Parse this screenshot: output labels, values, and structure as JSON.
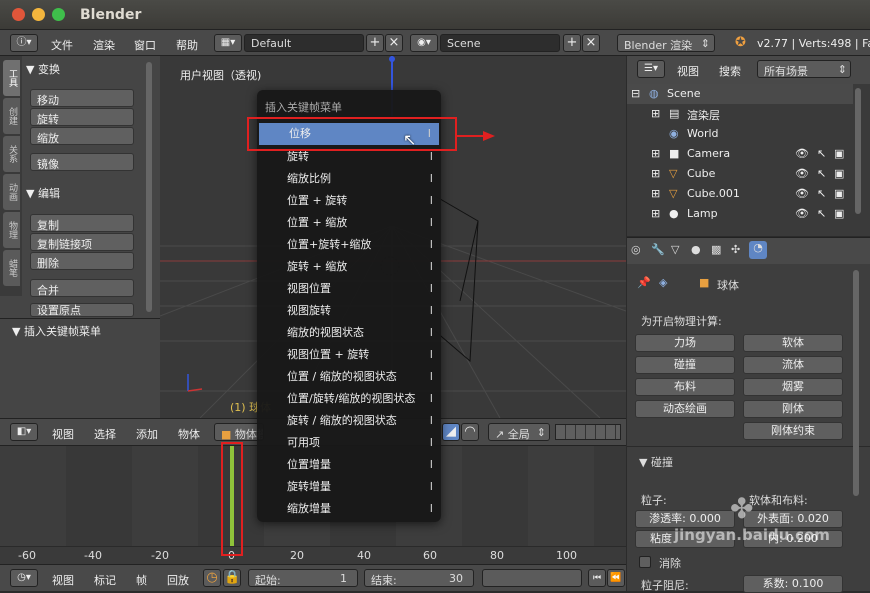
{
  "window": {
    "title": "Blender"
  },
  "info_bar": {
    "menus": [
      "文件",
      "渲染",
      "窗口",
      "帮助"
    ],
    "layout": "Default",
    "scene": "Scene",
    "engine": "Blender 渲染",
    "version": "v2.77 | Verts:498 | Fa"
  },
  "toolshelf": {
    "tabs": [
      "工具",
      "创建",
      "关系",
      "动画",
      "物理",
      "蜡笔"
    ],
    "transform_header": "▼ 变换",
    "transform_buttons": [
      "移动",
      "旋转",
      "缩放"
    ],
    "mirror": "镜像",
    "edit_header": "▼ 编辑",
    "edit_buttons": [
      "复制",
      "复制链接项",
      "删除"
    ],
    "join": "合并",
    "set_origin": "设置原点",
    "keyframe_menu_header": "▼ 插入关键帧菜单"
  },
  "viewport": {
    "label": "用户视图（透视)",
    "object_label": "(1) 球体"
  },
  "view_header": {
    "items": [
      "视图",
      "选择",
      "添加",
      "物体"
    ],
    "mode": "物体模式",
    "global": "全局"
  },
  "keyframe_menu": {
    "title": "插入关键帧菜单",
    "items": [
      "位移",
      "旋转",
      "缩放比例",
      "位置 + 旋转",
      "位置 + 缩放",
      "位置+旋转+缩放",
      "旋转 + 缩放",
      "视图位置",
      "视图旋转",
      "缩放的视图状态",
      "视图位置 + 旋转",
      "位置 / 缩放的视图状态",
      "位置/旋转/缩放的视图状态",
      "旋转 / 缩放的视图状态",
      "可用项",
      "位置增量",
      "旋转增量",
      "缩放增量"
    ],
    "shortcut": "I",
    "selected_index": 0
  },
  "timeline": {
    "ruler": [
      "-60",
      "-40",
      "-20",
      "0",
      "20",
      "40",
      "60",
      "80",
      "100"
    ]
  },
  "timeline_footer": {
    "items": [
      "视图",
      "标记",
      "帧",
      "回放"
    ],
    "start_label": "起始:",
    "start": "1",
    "end_label": "结束:",
    "end": "30"
  },
  "outliner": {
    "menus": [
      "视图",
      "搜索"
    ],
    "filter": "所有场景",
    "rows": [
      "Scene",
      "渲染层",
      "World",
      "Camera",
      "Cube",
      "Cube.001",
      "Lamp"
    ]
  },
  "properties": {
    "object_name": "球体",
    "physics_label": "为开启物理计算:",
    "buttons_left": [
      "力场",
      "碰撞",
      "布料",
      "动态绘画"
    ],
    "buttons_right": [
      "软体",
      "流体",
      "烟雾",
      "刚体",
      "刚体约束"
    ],
    "collision_header": "▼ 碰撞",
    "particles_label": "粒子:",
    "softbody_label": "软体和布料:",
    "permeability": "渗透率: 0.000",
    "outer": "外表面: 0.020",
    "stickiness": "粘度",
    "inner": "内: 0.200",
    "kill": "消除",
    "damping": "粒子阻尼:",
    "factor": "系数:",
    "factor_value": "0.100"
  },
  "watermark": {
    "site": "jingyan.baidu.com"
  },
  "colors": {
    "selected": "#5f86c4",
    "highlight": "#e02020",
    "timeline_frame": "#8fc33a"
  }
}
